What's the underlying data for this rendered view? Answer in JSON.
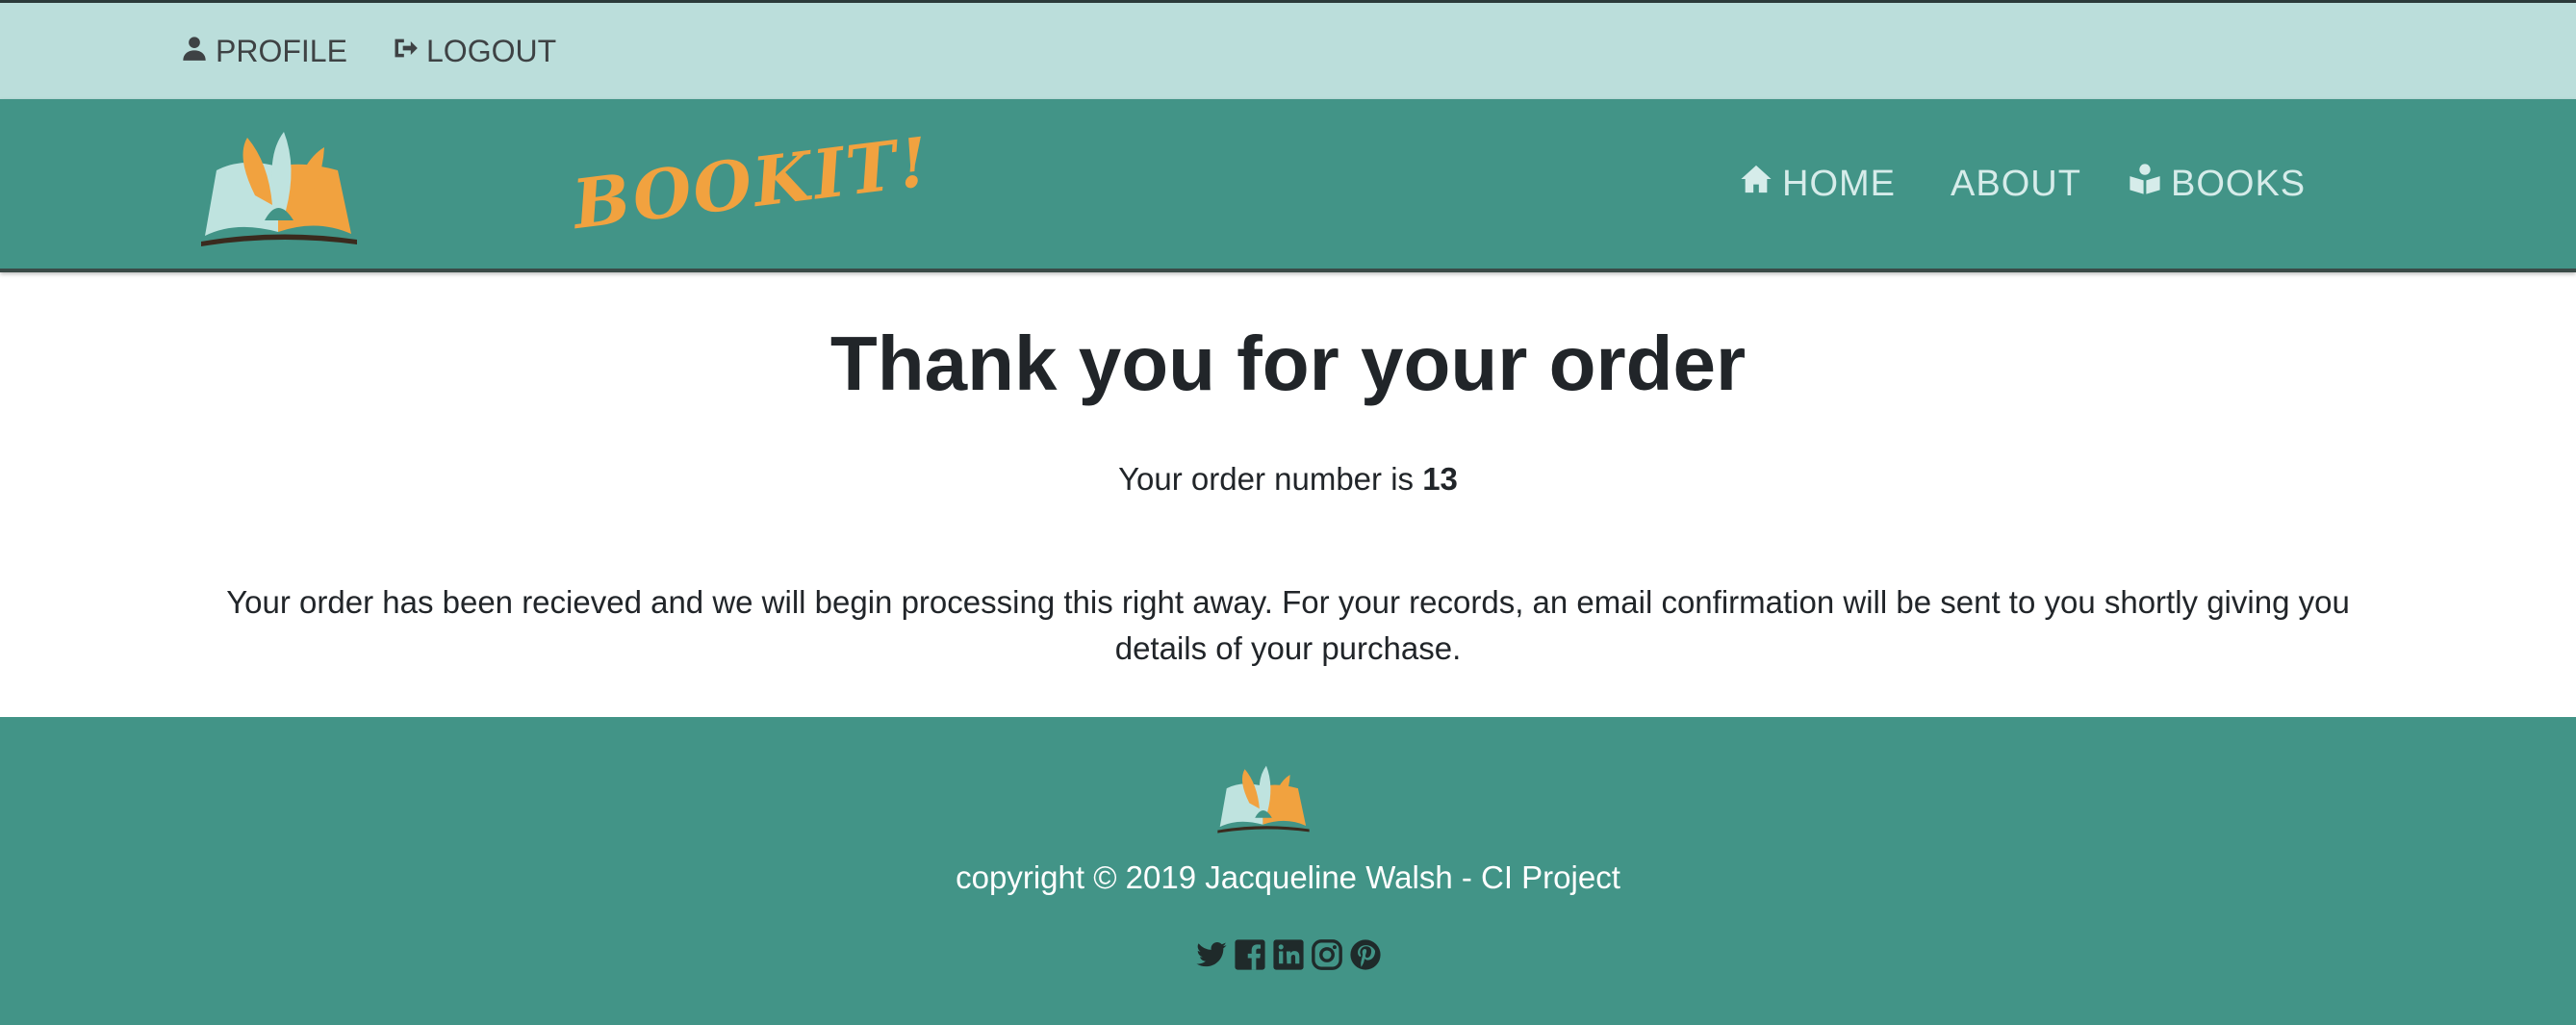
{
  "topbar": {
    "profile_label": "PROFILE",
    "logout_label": "LOGOUT"
  },
  "brand": {
    "name": "BOOKIT!"
  },
  "nav": {
    "home_label": "HOME",
    "about_label": "ABOUT",
    "books_label": "BOOKS"
  },
  "main": {
    "title": "Thank you for your order",
    "order_prefix": "Your order number is ",
    "order_number": "13",
    "message": "Your order has been recieved and we will begin processing this right away. For your records, an email confirmation will be sent to you shortly giving you details of your purchase."
  },
  "footer": {
    "copyright": "copyright © 2019 Jacqueline Walsh - CI Project",
    "social_icons": [
      "twitter-icon",
      "facebook-icon",
      "linkedin-icon",
      "instagram-icon",
      "pinterest-icon"
    ]
  },
  "colors": {
    "topbar_bg": "#bbdedb",
    "navbar_bg": "#429487",
    "brand_orange": "#f1a23f",
    "brand_mint": "#bfe3df"
  }
}
